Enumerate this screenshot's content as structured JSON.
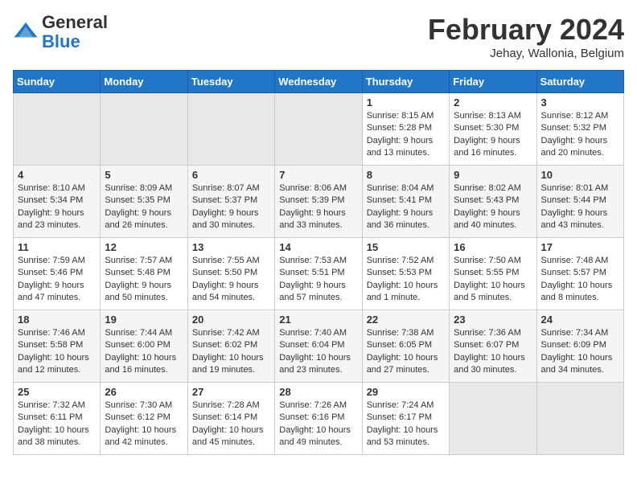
{
  "header": {
    "logo_general": "General",
    "logo_blue": "Blue",
    "month_title": "February 2024",
    "location": "Jehay, Wallonia, Belgium"
  },
  "days_of_week": [
    "Sunday",
    "Monday",
    "Tuesday",
    "Wednesday",
    "Thursday",
    "Friday",
    "Saturday"
  ],
  "weeks": [
    [
      {
        "day": "",
        "info": ""
      },
      {
        "day": "",
        "info": ""
      },
      {
        "day": "",
        "info": ""
      },
      {
        "day": "",
        "info": ""
      },
      {
        "day": "1",
        "info": "Sunrise: 8:15 AM\nSunset: 5:28 PM\nDaylight: 9 hours\nand 13 minutes."
      },
      {
        "day": "2",
        "info": "Sunrise: 8:13 AM\nSunset: 5:30 PM\nDaylight: 9 hours\nand 16 minutes."
      },
      {
        "day": "3",
        "info": "Sunrise: 8:12 AM\nSunset: 5:32 PM\nDaylight: 9 hours\nand 20 minutes."
      }
    ],
    [
      {
        "day": "4",
        "info": "Sunrise: 8:10 AM\nSunset: 5:34 PM\nDaylight: 9 hours\nand 23 minutes."
      },
      {
        "day": "5",
        "info": "Sunrise: 8:09 AM\nSunset: 5:35 PM\nDaylight: 9 hours\nand 26 minutes."
      },
      {
        "day": "6",
        "info": "Sunrise: 8:07 AM\nSunset: 5:37 PM\nDaylight: 9 hours\nand 30 minutes."
      },
      {
        "day": "7",
        "info": "Sunrise: 8:06 AM\nSunset: 5:39 PM\nDaylight: 9 hours\nand 33 minutes."
      },
      {
        "day": "8",
        "info": "Sunrise: 8:04 AM\nSunset: 5:41 PM\nDaylight: 9 hours\nand 36 minutes."
      },
      {
        "day": "9",
        "info": "Sunrise: 8:02 AM\nSunset: 5:43 PM\nDaylight: 9 hours\nand 40 minutes."
      },
      {
        "day": "10",
        "info": "Sunrise: 8:01 AM\nSunset: 5:44 PM\nDaylight: 9 hours\nand 43 minutes."
      }
    ],
    [
      {
        "day": "11",
        "info": "Sunrise: 7:59 AM\nSunset: 5:46 PM\nDaylight: 9 hours\nand 47 minutes."
      },
      {
        "day": "12",
        "info": "Sunrise: 7:57 AM\nSunset: 5:48 PM\nDaylight: 9 hours\nand 50 minutes."
      },
      {
        "day": "13",
        "info": "Sunrise: 7:55 AM\nSunset: 5:50 PM\nDaylight: 9 hours\nand 54 minutes."
      },
      {
        "day": "14",
        "info": "Sunrise: 7:53 AM\nSunset: 5:51 PM\nDaylight: 9 hours\nand 57 minutes."
      },
      {
        "day": "15",
        "info": "Sunrise: 7:52 AM\nSunset: 5:53 PM\nDaylight: 10 hours\nand 1 minute."
      },
      {
        "day": "16",
        "info": "Sunrise: 7:50 AM\nSunset: 5:55 PM\nDaylight: 10 hours\nand 5 minutes."
      },
      {
        "day": "17",
        "info": "Sunrise: 7:48 AM\nSunset: 5:57 PM\nDaylight: 10 hours\nand 8 minutes."
      }
    ],
    [
      {
        "day": "18",
        "info": "Sunrise: 7:46 AM\nSunset: 5:58 PM\nDaylight: 10 hours\nand 12 minutes."
      },
      {
        "day": "19",
        "info": "Sunrise: 7:44 AM\nSunset: 6:00 PM\nDaylight: 10 hours\nand 16 minutes."
      },
      {
        "day": "20",
        "info": "Sunrise: 7:42 AM\nSunset: 6:02 PM\nDaylight: 10 hours\nand 19 minutes."
      },
      {
        "day": "21",
        "info": "Sunrise: 7:40 AM\nSunset: 6:04 PM\nDaylight: 10 hours\nand 23 minutes."
      },
      {
        "day": "22",
        "info": "Sunrise: 7:38 AM\nSunset: 6:05 PM\nDaylight: 10 hours\nand 27 minutes."
      },
      {
        "day": "23",
        "info": "Sunrise: 7:36 AM\nSunset: 6:07 PM\nDaylight: 10 hours\nand 30 minutes."
      },
      {
        "day": "24",
        "info": "Sunrise: 7:34 AM\nSunset: 6:09 PM\nDaylight: 10 hours\nand 34 minutes."
      }
    ],
    [
      {
        "day": "25",
        "info": "Sunrise: 7:32 AM\nSunset: 6:11 PM\nDaylight: 10 hours\nand 38 minutes."
      },
      {
        "day": "26",
        "info": "Sunrise: 7:30 AM\nSunset: 6:12 PM\nDaylight: 10 hours\nand 42 minutes."
      },
      {
        "day": "27",
        "info": "Sunrise: 7:28 AM\nSunset: 6:14 PM\nDaylight: 10 hours\nand 45 minutes."
      },
      {
        "day": "28",
        "info": "Sunrise: 7:26 AM\nSunset: 6:16 PM\nDaylight: 10 hours\nand 49 minutes."
      },
      {
        "day": "29",
        "info": "Sunrise: 7:24 AM\nSunset: 6:17 PM\nDaylight: 10 hours\nand 53 minutes."
      },
      {
        "day": "",
        "info": ""
      },
      {
        "day": "",
        "info": ""
      }
    ]
  ]
}
